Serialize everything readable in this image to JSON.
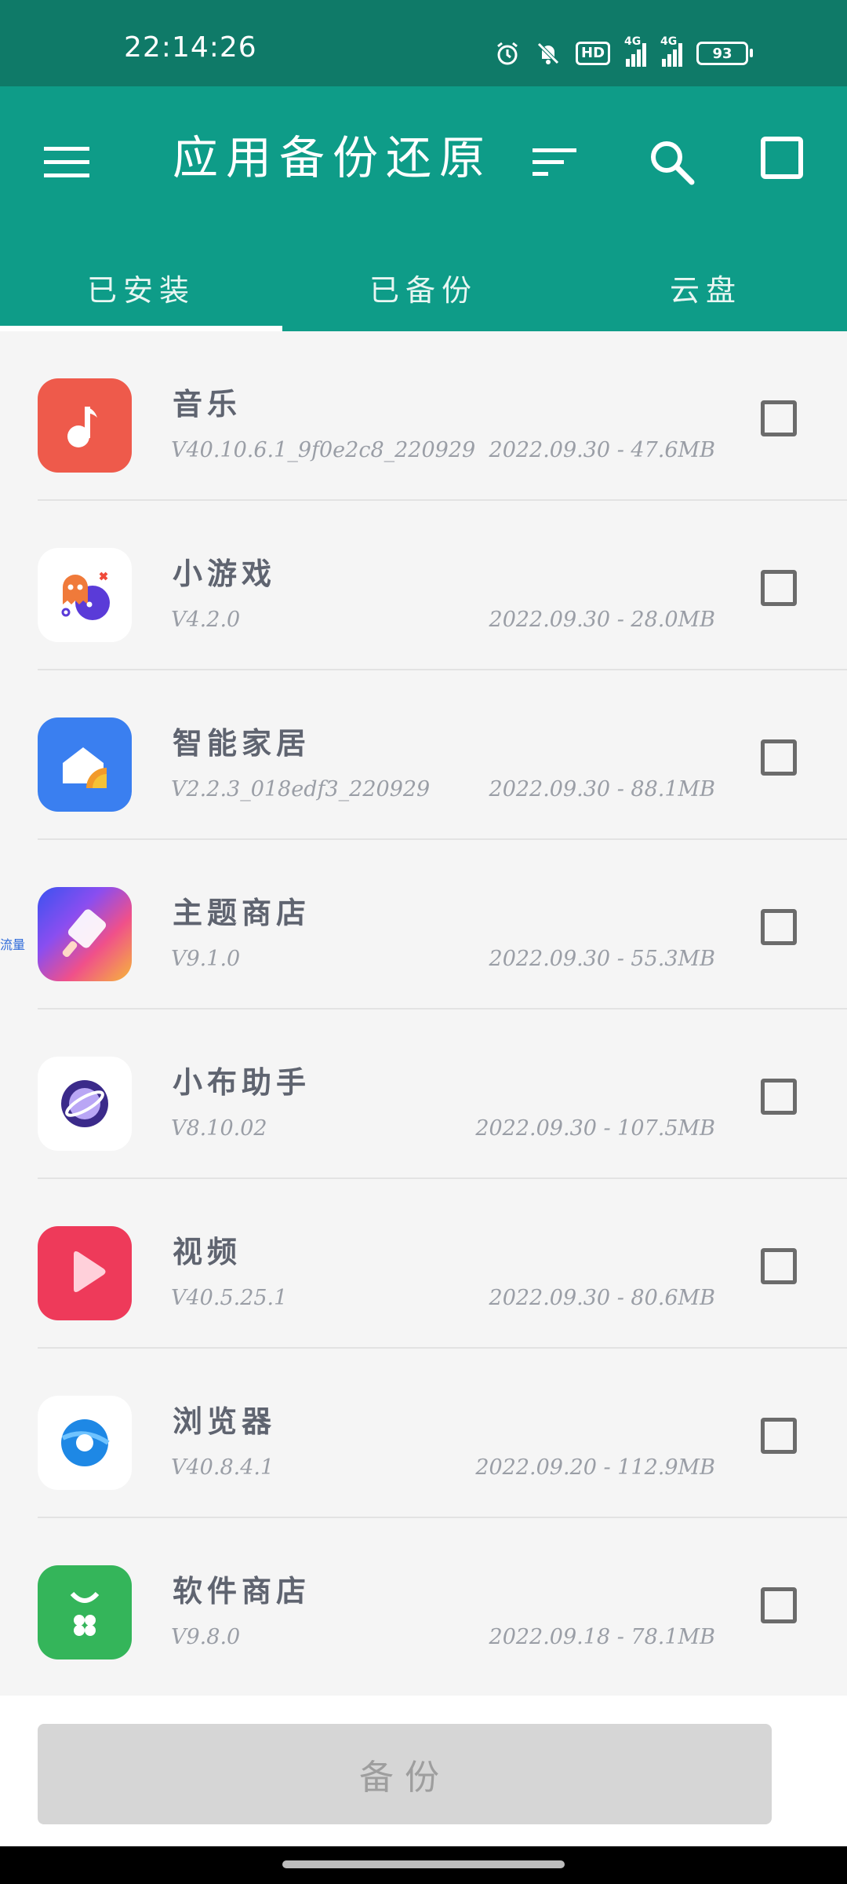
{
  "status_bar": {
    "time": "22:14:26",
    "battery": "93",
    "hd_label": "HD",
    "network_label_1": "4G",
    "network_label_2": "4G",
    "icons": [
      "alarm-icon",
      "mute-icon",
      "hd-icon",
      "signal-4g-icon",
      "signal-4g-icon",
      "battery-icon"
    ]
  },
  "app_bar": {
    "title": "应用备份还原",
    "menu_icon": "menu-icon",
    "sort_icon": "sort-icon",
    "search_icon": "search-icon",
    "select_all_icon": "checkbox-icon",
    "background": "#0e9c88"
  },
  "tabs": [
    {
      "label": "已安装",
      "active": true
    },
    {
      "label": "已备份",
      "active": false
    },
    {
      "label": "云盘",
      "active": false
    }
  ],
  "apps": [
    {
      "name": "音乐",
      "version": "V40.10.6.1_9f0e2c8_220929",
      "meta": "2022.09.30 - 47.6MB",
      "icon": "music-note-icon",
      "color": "#ee5a4b"
    },
    {
      "name": "小游戏",
      "version": "V4.2.0",
      "meta": "2022.09.30 - 28.0MB",
      "icon": "game-icon",
      "color": "#ffffff"
    },
    {
      "name": "智能家居",
      "version": "V2.2.3_018edf3_220929",
      "meta": "2022.09.30 - 88.1MB",
      "icon": "smart-home-icon",
      "color": "#3a7ff0"
    },
    {
      "name": "主题商店",
      "version": "V9.1.0",
      "meta": "2022.09.30 - 55.3MB",
      "icon": "theme-brush-icon",
      "color": "#6a5cf0"
    },
    {
      "name": "小布助手",
      "version": "V8.10.02",
      "meta": "2022.09.30 - 107.5MB",
      "icon": "planet-icon",
      "color": "#ffffff"
    },
    {
      "name": "视频",
      "version": "V40.5.25.1",
      "meta": "2022.09.30 - 80.6MB",
      "icon": "play-icon",
      "color": "#ee3a5a"
    },
    {
      "name": "浏览器",
      "version": "V40.8.4.1",
      "meta": "2022.09.20 - 112.9MB",
      "icon": "browser-icon",
      "color": "#ffffff"
    },
    {
      "name": "软件商店",
      "version": "V9.8.0",
      "meta": "2022.09.18 - 78.1MB",
      "icon": "store-bag-icon",
      "color": "#34b55a"
    }
  ],
  "side_tag": "流量",
  "backup_button": "备份"
}
